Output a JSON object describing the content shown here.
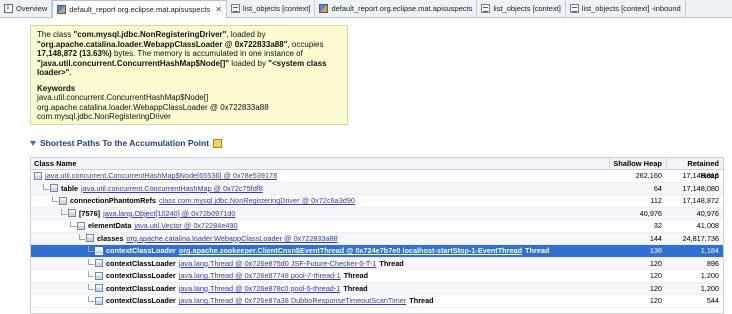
{
  "tabs": [
    {
      "label": "Overview",
      "icon": "info-icon",
      "active": false,
      "closable": false
    },
    {
      "label": "default_report  org.eclipse.mat.apisuspects",
      "icon": "report-icon",
      "active": true,
      "closable": true
    },
    {
      "label": "list_objects  [context]",
      "icon": "list-icon",
      "active": false,
      "closable": false
    },
    {
      "label": "default_report  org.eclipse.mat.apisuspects",
      "icon": "report-icon",
      "active": false,
      "closable": false
    },
    {
      "label": "list_objects  [context]",
      "icon": "list-icon",
      "active": false,
      "closable": false
    },
    {
      "label": "list_objects  [context] -inbound",
      "icon": "list-icon",
      "active": false,
      "closable": false
    }
  ],
  "close_glyph": "✕",
  "suspect": {
    "p1": "The class ",
    "b1": "\"com.mysql.jdbc.NonRegisteringDriver\"",
    "p2": ", loaded by ",
    "b2": "\"org.apache.catalina.loader.WebappClassLoader @ 0x722833a88\"",
    "p3": ", occupies ",
    "b3": "17,148,872 (13.63%)",
    "p4": " bytes. The memory is accumulated in one instance of ",
    "b4": "\"java.util.concurrent.ConcurrentHashMap$Node[]\"",
    "p5": " loaded by ",
    "b5": "\"<system class loader>\"",
    "p6": ".",
    "keywords_title": "Keywords",
    "keywords": [
      "java.util.concurrent.ConcurrentHashMap$Node[]",
      "org.apache.catalina.loader.WebappClassLoader @ 0x722833a88",
      "com.mysql.jdbc.NonRegisteringDriver"
    ]
  },
  "section": {
    "title": "Shortest Paths To the Accumulation Point"
  },
  "table": {
    "columns": {
      "name": "Class Name",
      "shallow": "Shallow Heap",
      "retained": "Retained Heap"
    },
    "rows": [
      {
        "indent": 0,
        "field": "",
        "link": "java.util.concurrent.ConcurrentHashMap$Node[65536] @ 0x78e539178",
        "suffix": "",
        "shallow": "262,160",
        "retained": "17,148,016"
      },
      {
        "indent": 1,
        "field": "table",
        "link": "java.util.concurrent.ConcurrentHashMap @ 0x72c75fdf8",
        "suffix": "",
        "shallow": "64",
        "retained": "17,148,080"
      },
      {
        "indent": 2,
        "field": "connectionPhantomRefs",
        "link": "class com.mysql.jdbc.NonRegisteringDriver @ 0x72c6a3d90",
        "suffix": "",
        "shallow": "112",
        "retained": "17,148,872"
      },
      {
        "indent": 3,
        "field": "[7576]",
        "link": "java.lang.Object[10240] @ 0x72b0971d0",
        "suffix": "",
        "shallow": "40,976",
        "retained": "40,976"
      },
      {
        "indent": 4,
        "field": "elementData",
        "link": "java.util.Vector @ 0x72284e490",
        "suffix": "",
        "shallow": "32",
        "retained": "41,008"
      },
      {
        "indent": 5,
        "field": "classes",
        "link": "org.apache.catalina.loader.WebappClassLoader @ 0x722833a88",
        "suffix": "",
        "shallow": "144",
        "retained": "24,817,736"
      },
      {
        "indent": 6,
        "field": "contextClassLoader",
        "link": "org.apache.zookeeper.ClientCnxn$EventThread @ 0x724e7b7e0 localhost-startStop-1-EventThread",
        "suffix": "Thread",
        "shallow": "136",
        "retained": "1,184",
        "selected": true
      },
      {
        "indent": 6,
        "field": "contextClassLoader",
        "link": "java.lang.Thread @ 0x726e875d0 JSF-Future-Checker-0-T-1",
        "suffix": "Thread",
        "shallow": "120",
        "retained": "896"
      },
      {
        "indent": 6,
        "field": "contextClassLoader",
        "link": "java.lang.Thread @ 0x726e87748 pool-7-thread-1",
        "suffix": "Thread",
        "shallow": "120",
        "retained": "1,200"
      },
      {
        "indent": 6,
        "field": "contextClassLoader",
        "link": "java.lang.Thread @ 0x726e878c0 pool-5-thread-1",
        "suffix": "Thread",
        "shallow": "120",
        "retained": "1,200"
      },
      {
        "indent": 6,
        "field": "contextClassLoader",
        "link": "java.lang.Thread @ 0x726e87a38 DubboResponseTimeoutScanTimer",
        "suffix": "Thread",
        "shallow": "120",
        "retained": "544"
      }
    ]
  }
}
